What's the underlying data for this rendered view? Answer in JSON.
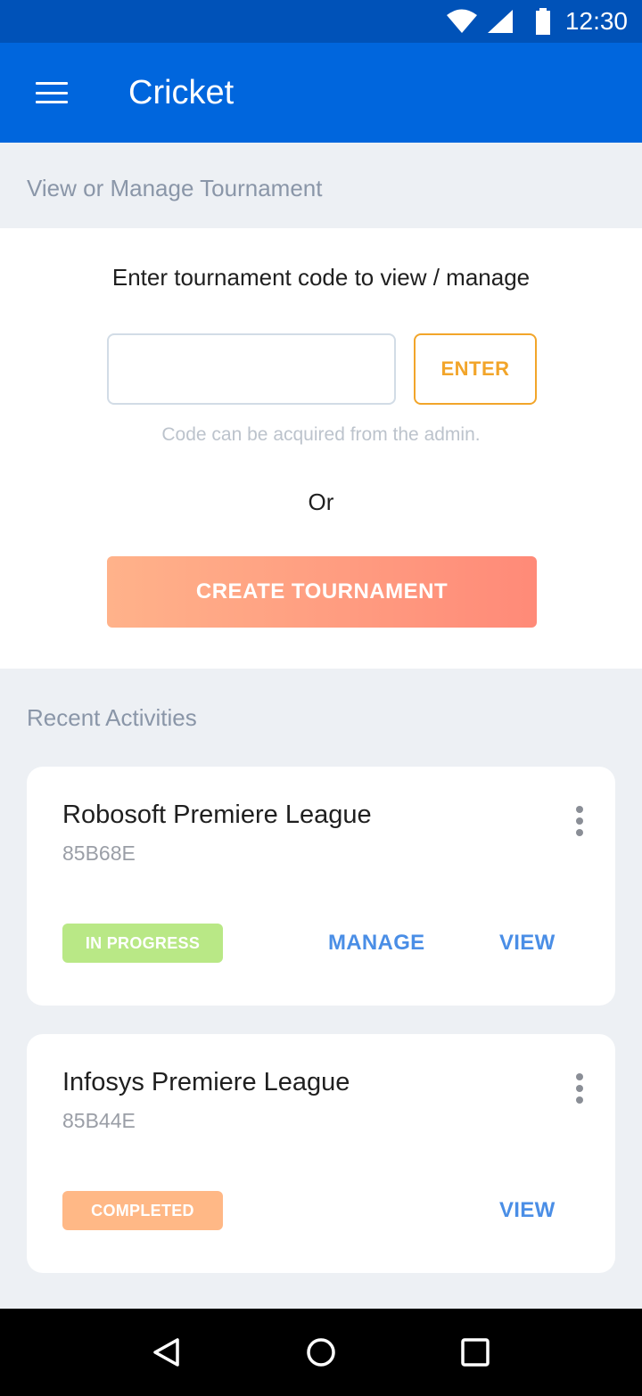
{
  "status_bar": {
    "time": "12:30",
    "icons": [
      "wifi-icon",
      "signal-icon",
      "battery-icon"
    ]
  },
  "app_bar": {
    "title": "Cricket",
    "menu_icon": "hamburger-menu-icon"
  },
  "manage": {
    "section_title": "View or Manage Tournament",
    "prompt": "Enter tournament code to view / manage",
    "code_value": "",
    "code_placeholder": "",
    "enter_label": "ENTER",
    "hint": "Code can be acquired from the admin.",
    "or_label": "Or",
    "create_label": "CREATE TOURNAMENT"
  },
  "recent": {
    "section_title": "Recent Activities",
    "items": [
      {
        "title": "Robosoft Premiere League",
        "code": "85B68E",
        "status": "IN PROGRESS",
        "status_color": "#b9e886",
        "manage_label": "MANAGE",
        "view_label": "VIEW"
      },
      {
        "title": "Infosys Premiere League",
        "code": "85B44E",
        "status": "COMPLETED",
        "status_color": "#ffb886",
        "view_label": "VIEW"
      }
    ]
  },
  "colors": {
    "status_bar": "#0052b8",
    "app_bar": "#0066dd",
    "accent_orange": "#f2a52a",
    "link_blue": "#4a8ee6"
  },
  "nav_bar": {
    "icons": [
      "back-icon",
      "home-icon",
      "recents-icon"
    ]
  }
}
